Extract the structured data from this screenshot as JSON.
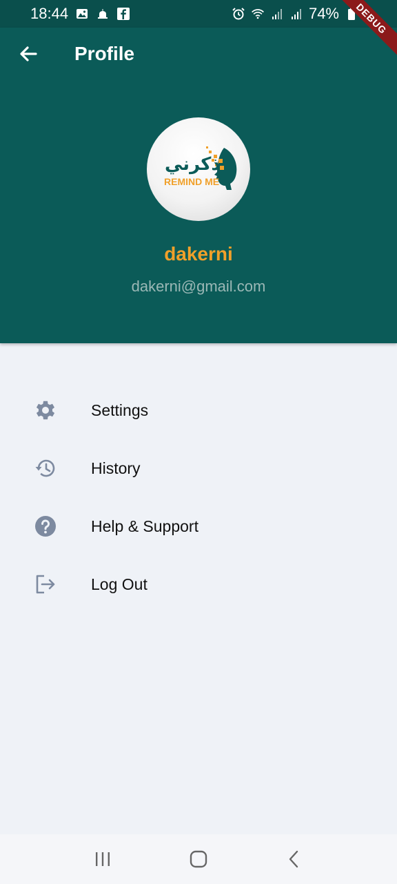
{
  "status_bar": {
    "time": "18:44",
    "battery": "74%",
    "left_icons": [
      "image-icon",
      "mosque-icon",
      "facebook-icon"
    ],
    "right_icons": [
      "alarm-icon",
      "wifi-icon",
      "signal-icon",
      "signal-icon",
      "battery-icon"
    ]
  },
  "header": {
    "title": "Profile",
    "back_icon": "arrow-left-icon",
    "logo_arabic": "ذكرني",
    "logo_english": "REMIND ME",
    "user_name": "dakerni",
    "user_email": "dakerni@gmail.com"
  },
  "menu": {
    "items": [
      {
        "label": "Settings",
        "icon": "gear-icon"
      },
      {
        "label": "History",
        "icon": "history-icon"
      },
      {
        "label": "Help & Support",
        "icon": "help-icon"
      },
      {
        "label": "Log Out",
        "icon": "logout-icon"
      }
    ]
  },
  "debug_banner": "DEBUG",
  "nav_bar": {
    "buttons": [
      "recent-apps-icon",
      "home-icon",
      "back-icon"
    ]
  },
  "colors": {
    "header_bg": "#0b5b58",
    "status_bg": "#0a4f4c",
    "accent_orange": "#f0a02a",
    "email_text": "#9bb8b6",
    "page_bg": "#eff2f7",
    "icon_gray": "#7d8aa0"
  }
}
